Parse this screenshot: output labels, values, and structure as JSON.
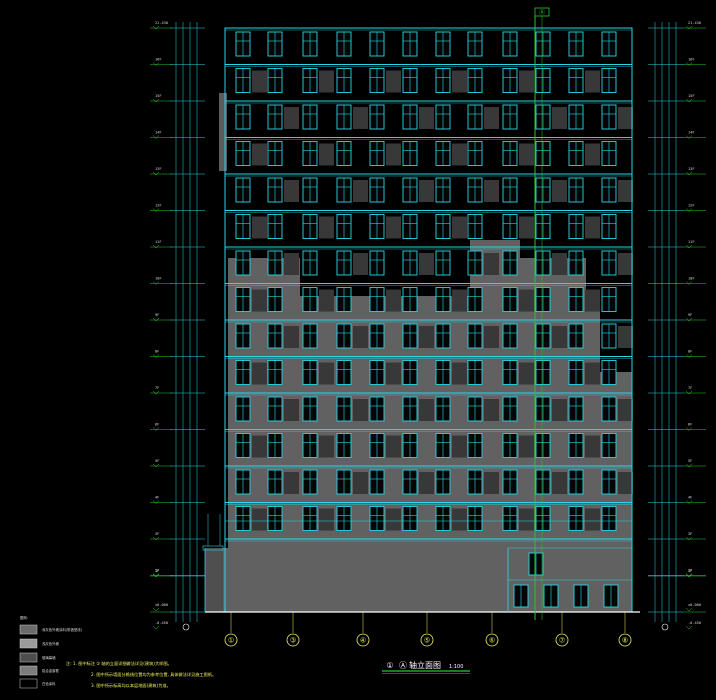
{
  "drawing": {
    "title_number": "①",
    "title_axis": "Ⓐ",
    "title_label": "轴立面图",
    "scale": "1:100",
    "top_axis": "Ⓐ"
  },
  "axes": [
    "①",
    "③",
    "④",
    "⑤",
    "⑥",
    "⑦",
    "⑧"
  ],
  "levels": {
    "left": [
      "21.430",
      "16F",
      "15F",
      "14F",
      "13F",
      "12F",
      "11F",
      "10F",
      "9F",
      "8F",
      "7F",
      "6F",
      "5F",
      "4F",
      "3F",
      "2F",
      "1F",
      "±0.000",
      "-0.450"
    ],
    "right": [
      "21.430",
      "16F",
      "15F",
      "14F",
      "13F",
      "12F",
      "11F",
      "10F",
      "9F",
      "8F",
      "7F",
      "6F",
      "5F",
      "4F",
      "3F",
      "2F",
      "1F",
      "±0.000",
      "-0.450"
    ]
  },
  "legend": {
    "title": "图例:",
    "items": [
      {
        "label": "深灰色外墙涂料(带造型线)",
        "color": "#6b6b6b"
      },
      {
        "label": "浅灰色外墙",
        "color": "#9a9a9a"
      },
      {
        "label": "玻璃幕墙",
        "color": "#4d4d4d"
      },
      {
        "label": "铝合金窗框",
        "color": "#7d7d7d"
      },
      {
        "label": "白色涂料",
        "color": "#000000"
      }
    ]
  },
  "notes": [
    "注: 1. 图中标注 ① 轴的立面详细做法详见(建筑)大样图。",
    "2. 图中所示墙面分格线位置均为参考位置, 具体做法详见施工图纸。",
    "3. 图中所示标高均以本层地面(建筑)为准。"
  ],
  "colors": {
    "background": "#000000",
    "facade_fill": "#616161",
    "cyan": "#27d8e6",
    "green": "#28c82d",
    "yellow": "#f2f25a"
  }
}
